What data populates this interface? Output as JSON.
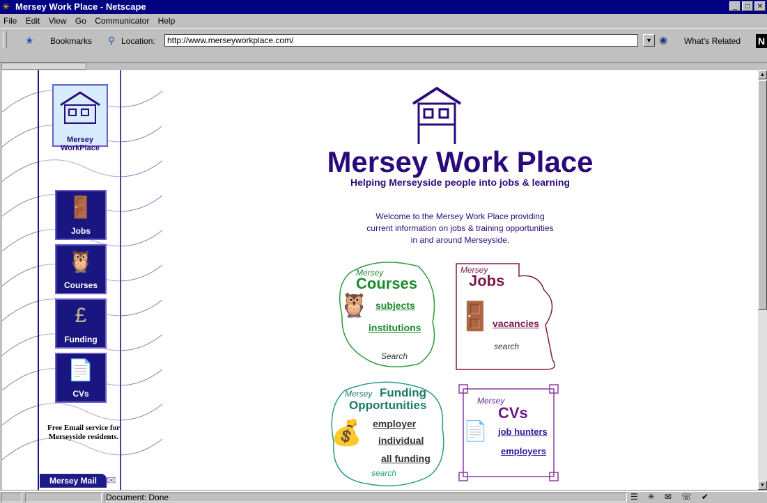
{
  "window": {
    "title": "Mersey Work Place - Netscape",
    "controls": {
      "minimize": "_",
      "maximize": "□",
      "close": "✕"
    }
  },
  "menu": [
    "File",
    "Edit",
    "View",
    "Go",
    "Communicator",
    "Help"
  ],
  "toolbar": {
    "bookmarks_label": "Bookmarks",
    "location_label": "Location:",
    "url": "http://www.merseyworkplace.com/",
    "related_label": "What's Related",
    "netscape_logo": "N"
  },
  "sidebar": {
    "logo_label": "Mersey WorkPlace",
    "nav": [
      {
        "label": "Jobs",
        "icon": "door-person-icon"
      },
      {
        "label": "Courses",
        "icon": "owl-icon"
      },
      {
        "label": "Funding",
        "icon": "money-bag-icon"
      },
      {
        "label": "CVs",
        "icon": "cv-icon"
      }
    ],
    "free_email": "Free Email service for Merseyside residents.",
    "mersey_mail": "Mersey Mail"
  },
  "main": {
    "brand": "Mersey Work Place",
    "tagline": "Helping Merseyside people into jobs & learning",
    "welcome": [
      "Welcome to the Mersey Work Place providing",
      "current information on jobs & training opportunities",
      "in and around Merseyside."
    ],
    "courses": {
      "small": "Mersey",
      "title": "Courses",
      "links": [
        "subjects",
        "institutions"
      ],
      "search": "Search"
    },
    "jobs": {
      "small": "Mersey",
      "title": "Jobs",
      "links": [
        "vacancies"
      ],
      "search": "search"
    },
    "funding": {
      "small": "Mersey",
      "title1": "Funding",
      "title2": "Opportunities",
      "links": [
        "employer",
        "individual",
        "all funding"
      ],
      "search": "search"
    },
    "cvs": {
      "small": "Mersey",
      "title": "CVs",
      "links": [
        "job hunters",
        "employers"
      ]
    }
  },
  "status": {
    "text": "Document: Done"
  },
  "colors": {
    "brand": "#2a0a7a",
    "sidebar_tile": "#1a1680",
    "title_bar": "#000080"
  }
}
